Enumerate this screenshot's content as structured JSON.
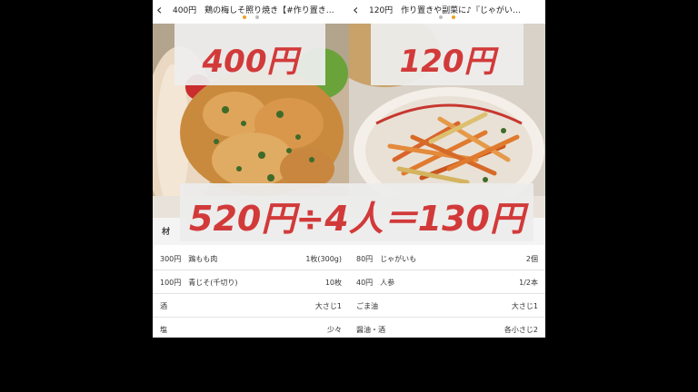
{
  "left": {
    "title": "400円　鶏の梅しそ照り焼き【#作り置き…",
    "price_label": "400円",
    "dots": [
      "#f0a020",
      "#bbbbbb"
    ],
    "ingredients": [
      {
        "name": "300円　鶏もも肉",
        "qty": "1枚(300g)"
      },
      {
        "name": "100円　青じそ(千切り)",
        "qty": "10枚"
      },
      {
        "name": "酒",
        "qty": "大さじ1"
      },
      {
        "name": "塩",
        "qty": "少々"
      }
    ]
  },
  "right": {
    "title": "120円　作り置きや副菜に♪『じゃがい…",
    "price_label": "120円",
    "dots": [
      "#bbbbbb",
      "#f0a020"
    ],
    "ingredients": [
      {
        "name": "80円　じゃがいも",
        "qty": "2個"
      },
      {
        "name": "40円　人参",
        "qty": "1/2本"
      },
      {
        "name": "ごま油",
        "qty": "大さじ1"
      },
      {
        "name": "醤油・酒",
        "qty": "各小さじ2"
      }
    ]
  },
  "formula": "520円÷4人＝130円",
  "colors": {
    "accent": "#d23a3a",
    "active_dot": "#f0a020"
  },
  "icons": {
    "back": "chevron-left-icon"
  }
}
